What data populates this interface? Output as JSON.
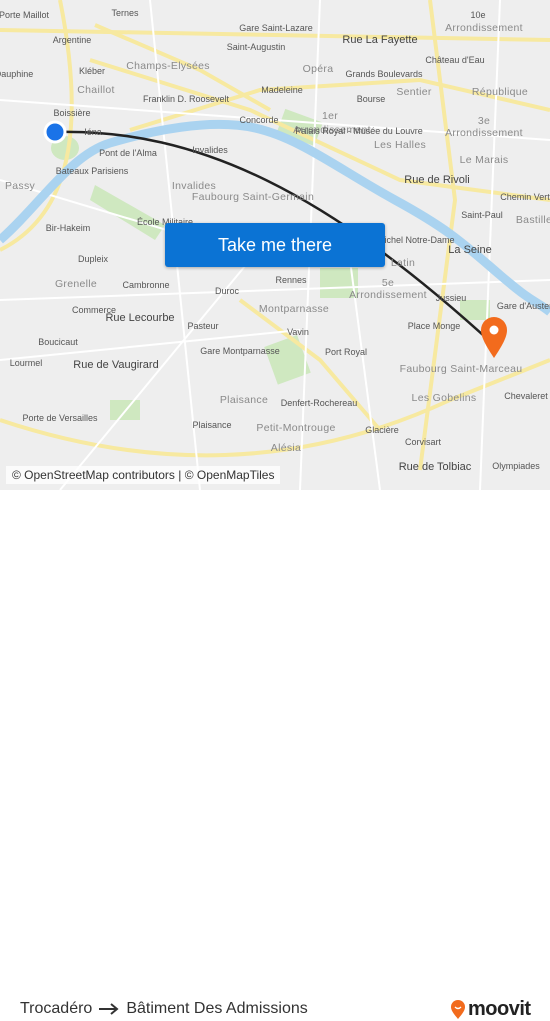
{
  "map": {
    "labels": [
      "Porte Maillot",
      "Ternes",
      "Gare Saint-Lazare",
      "Rue La Fayette",
      "10e",
      "Arrondissement",
      "Argentine",
      "Saint-Augustin",
      "Château d'Eau",
      "Dauphine",
      "Kléber",
      "Champs-Elysées",
      "Opéra",
      "Grands Boulevards",
      "Sentier",
      "République",
      "Chaillot",
      "Franklin D. Roosevelt",
      "Madeleine",
      "Bourse",
      "Boissière",
      "1er",
      "Arrondissement",
      "3e",
      "Arrondissement",
      "Iéna",
      "Concorde",
      "Pont de l'Alma",
      "Invalides",
      "Palais Royal - Musée du Louvre",
      "Les Halles",
      "Le Marais",
      "Passy",
      "Bateaux Parisiens",
      "Invalides",
      "Faubourg Saint-Germain",
      "Rue de Rivoli",
      "Chemin Vert",
      "Saint-Paul",
      "École Militaire",
      "Bastille",
      "Bir-Hakeim",
      "Saint-Michel Notre-Dame",
      "La Seine",
      "Dupleix",
      "Grenelle",
      "Cambronne",
      "Rennes",
      "Latin",
      "Duroc",
      "5e",
      "Arrondissement",
      "Jussieu",
      "Commerce",
      "Rue Lecourbe",
      "Pasteur",
      "Montparnasse",
      "Place Monge",
      "Boucicaut",
      "Vavin",
      "Gare Montparnasse",
      "Port Royal",
      "Rue de Vaugirard",
      "Faubourg Saint-Marceau",
      "Lourmel",
      "Chevaleret",
      "Les Gobelins",
      "Plaisance",
      "Denfert-Rochereau",
      "Porte de Versailles",
      "Plaisance",
      "Petit-Montrouge",
      "Glacière",
      "Corvisart",
      "Alésia",
      "Rue de Tolbiac",
      "Olympiades",
      "Gare d'Austerlitz"
    ],
    "origin": "Trocadéro",
    "destination": "Bâtiment Des Admissions",
    "colors": {
      "route": "#222222",
      "origin": "#1a73e8",
      "destination": "#f26b1d",
      "river": "#aad3f0",
      "park": "#cfe8c0",
      "major_road": "#f7e9a0"
    }
  },
  "cta": {
    "label": "Take me there"
  },
  "attribution": "© OpenStreetMap contributors | © OpenMapTiles",
  "footer": {
    "origin": "Trocadéro",
    "arrow_icon": "arrow-right-icon",
    "destination": "Bâtiment Des Admissions",
    "brand": "moovit",
    "brand_color": "#f26b1d"
  }
}
